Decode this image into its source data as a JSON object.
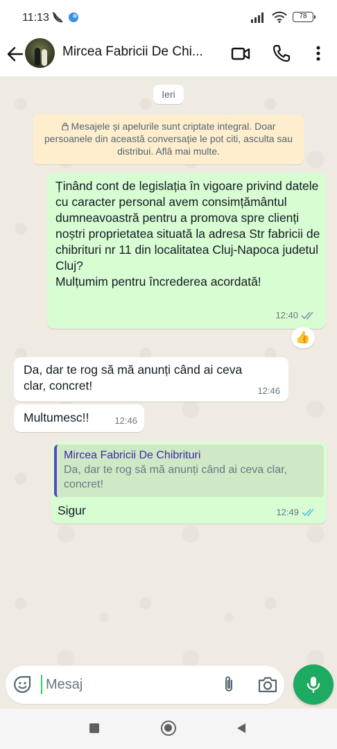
{
  "status_bar": {
    "time": "11:13",
    "battery": "78"
  },
  "header": {
    "contact_name": "Mircea Fabricii De Chi..."
  },
  "chat": {
    "date_label": "Ieri",
    "encryption_notice": "Mesajele și apelurile sunt criptate integral. Doar persoanele din această conversație le pot citi, asculta sau distribui. Află mai multe.",
    "messages": [
      {
        "direction": "out",
        "text": "Ținând cont de legislația în vigoare privind datele cu caracter personal avem consimțământul dumneavoastră pentru a promova spre clienți noștri proprietatea situată la adresa Str fabricii de chibrituri nr 11 din localitatea Cluj-Napoca judetul Cluj?\nMulțumim pentru încrederea acordată!",
        "time": "12:40",
        "status": "read",
        "reaction": "👍"
      },
      {
        "direction": "in",
        "text": "Da, dar te rog să mă anunți când ai ceva clar, concret!",
        "time": "12:46"
      },
      {
        "direction": "in",
        "text": "Multumesc!!",
        "time": "12:46"
      },
      {
        "direction": "out",
        "quote_author": "Mircea Fabricii De Chibrituri",
        "quote_text": "Da, dar te rog să mă anunți când ai ceva clar, concret!",
        "text": "Sigur",
        "time": "12:49",
        "status": "read"
      }
    ]
  },
  "composer": {
    "placeholder": "Mesaj"
  },
  "colors": {
    "outgoing_bubble": "#d9fdd3",
    "read_ticks": "#53bdeb",
    "mic_button": "#1daa61",
    "quote_bar": "#5b46c6"
  },
  "icons": {
    "status_left": [
      "mute-call-icon",
      "app-notification-icon"
    ],
    "status_right": [
      "signal-icon",
      "wifi-icon",
      "battery-icon"
    ],
    "header": [
      "back-arrow-icon",
      "video-call-icon",
      "voice-call-icon",
      "more-options-icon"
    ],
    "composer": [
      "emoji-sticker-icon",
      "attach-icon",
      "camera-icon",
      "microphone-icon"
    ],
    "nav": [
      "recents-icon",
      "home-icon",
      "back-icon"
    ]
  }
}
